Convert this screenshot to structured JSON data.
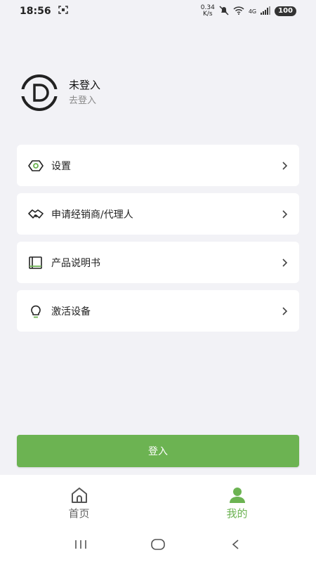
{
  "status_bar": {
    "time": "18:56",
    "net_speed_value": "0.34",
    "net_speed_unit": "K/s",
    "network_type": "4G",
    "battery": "100"
  },
  "profile": {
    "title": "未登入",
    "subtitle": "去登入"
  },
  "menu": {
    "items": [
      {
        "label": "设置",
        "icon": "settings-hexagon-icon"
      },
      {
        "label": "申请经销商/代理人",
        "icon": "handshake-icon"
      },
      {
        "label": "产品说明书",
        "icon": "book-icon"
      },
      {
        "label": "激活设备",
        "icon": "lightbulb-icon"
      }
    ]
  },
  "login_button": {
    "label": "登入"
  },
  "tabbar": {
    "tabs": [
      {
        "label": "首页",
        "icon": "home-icon",
        "active": false
      },
      {
        "label": "我的",
        "icon": "user-icon",
        "active": true
      }
    ]
  },
  "colors": {
    "accent": "#6cb352",
    "background": "#f2f2f6",
    "card": "#ffffff"
  }
}
